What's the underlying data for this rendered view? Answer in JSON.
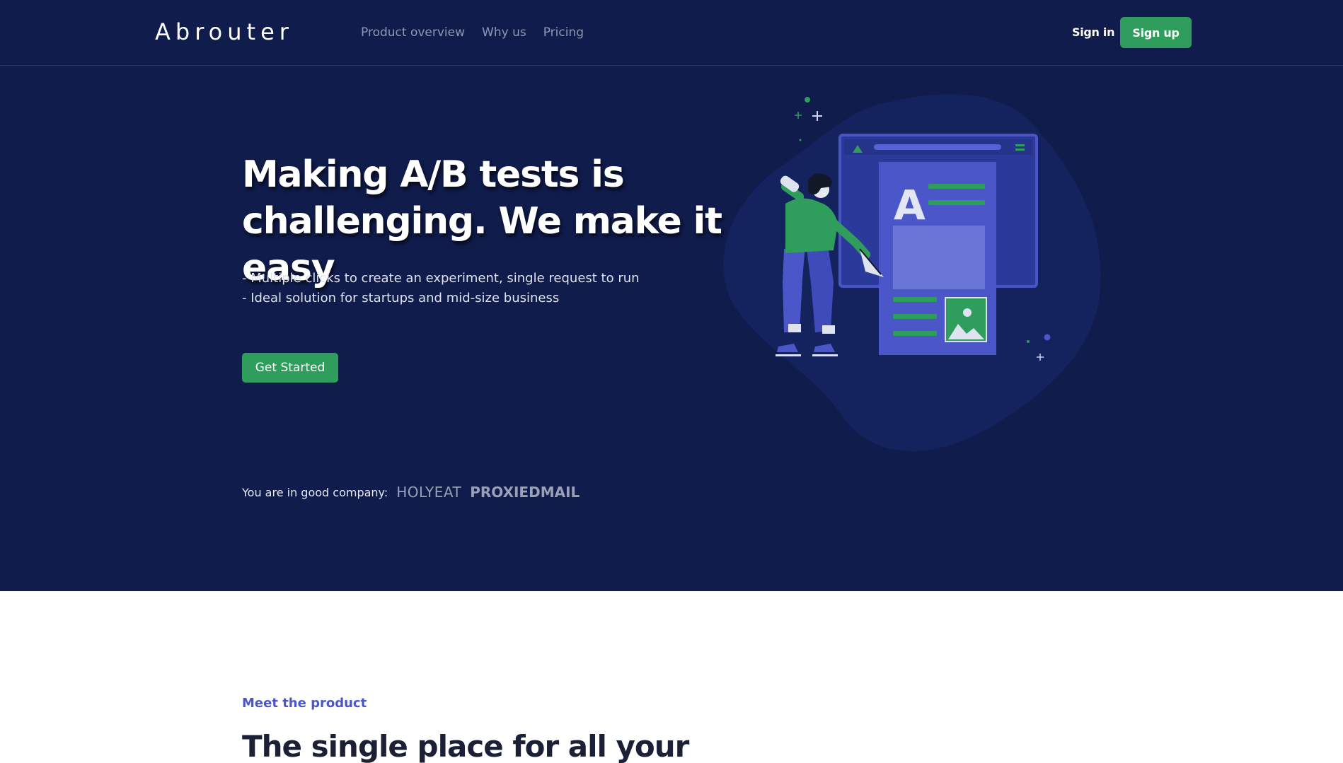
{
  "header": {
    "logo": "Abrouter",
    "nav": [
      "Product overview",
      "Why us",
      "Pricing"
    ],
    "sign_in": "Sign in",
    "sign_up": "Sign up"
  },
  "hero": {
    "headline_line1": "Making A/B tests is",
    "headline_line2": "challenging. We make it easy",
    "bullets": [
      "- Multiple clicks to create an experiment, single request to run",
      "- Ideal solution for startups and mid-size business"
    ],
    "cta": "Get Started",
    "company_label": "You are in good company:",
    "companies": [
      "HOLYEAT",
      "PROXIEDMAIL"
    ],
    "illustration_letter": "A"
  },
  "product": {
    "eyebrow": "Meet the product",
    "title": "The single place for all your"
  },
  "colors": {
    "hero_bg": "#101c4c",
    "accent_green": "#2f9e5c",
    "accent_blue": "#4b56c8"
  }
}
